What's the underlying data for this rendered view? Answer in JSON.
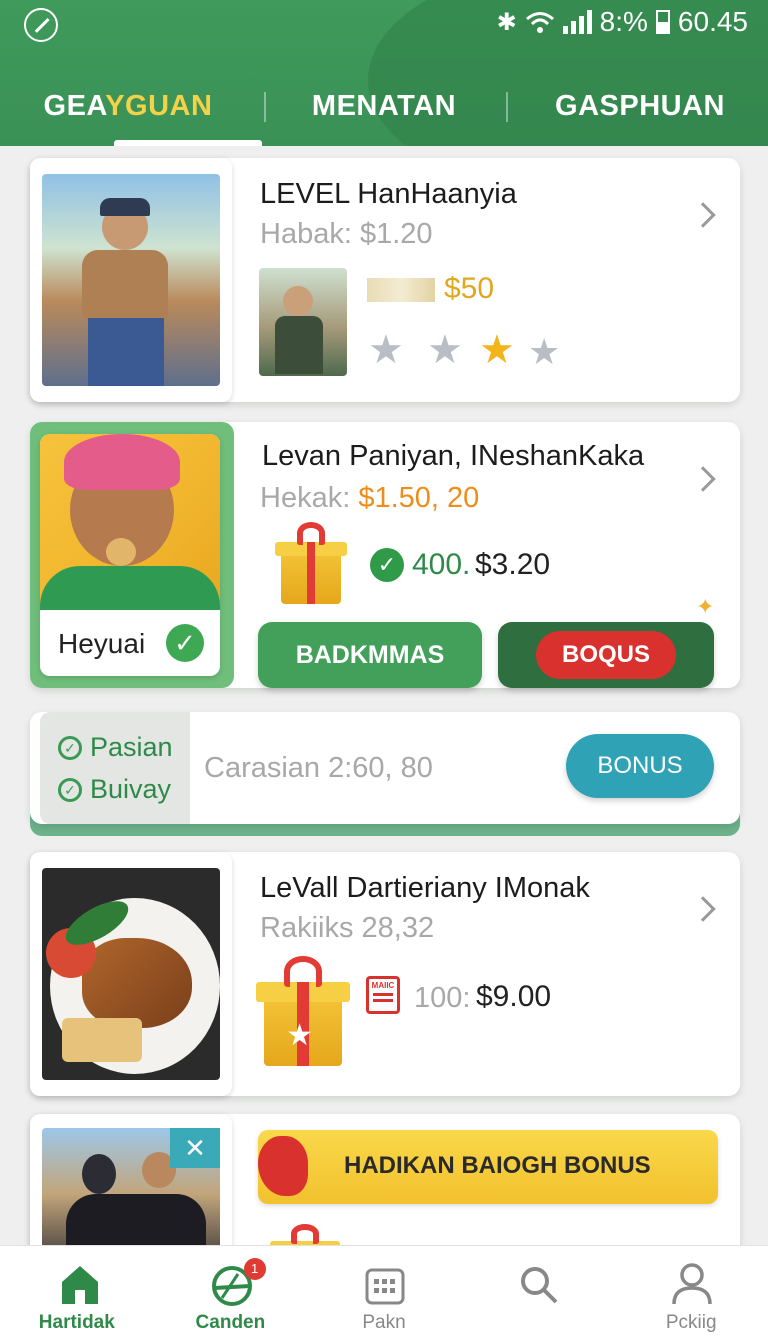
{
  "status": {
    "left_icon": "clock-icon",
    "battery_percent": "8:%",
    "time": "60.45",
    "icons": [
      "bluetooth-icon",
      "wifi-icon",
      "signal-icon",
      "battery-icon"
    ]
  },
  "tabs": [
    {
      "label_a": "GEA",
      "label_b": "YGUAN",
      "active": true
    },
    {
      "label": "MENATAN"
    },
    {
      "label": "GASPHUAN"
    }
  ],
  "cards": {
    "c1": {
      "title": "LEVEL HanHaanyia",
      "price_label": "Habak: $1.20",
      "reward_amount": "$50",
      "stars_filled": 1,
      "stars_total": 4
    },
    "c2": {
      "title": "Levan Paniyan, INeshanKaka",
      "price_prefix": "Hekak:",
      "price_value": "$1.50, 20",
      "count": "400.",
      "amount": "$3.20",
      "badge_label": "Heyuai",
      "btn_primary": "BADKMMAS",
      "btn_bonus": "BOQUS"
    },
    "c3": {
      "opt1": "Pasian",
      "opt2": "Buivay",
      "summary": "Carasian 2:60, 80",
      "btn": "BONUS"
    },
    "c4": {
      "title": "LeVall Dartieriany IMonak",
      "price_label": "Rakiiks 28,32",
      "calendar_text": "MAIIC",
      "count": "100:",
      "amount": "$9.00"
    },
    "c5": {
      "banner": "HADIKAN BAIOGH BONUS"
    }
  },
  "nav": [
    {
      "label": "Hartidak",
      "icon": "home-icon",
      "active": true
    },
    {
      "label": "Canden",
      "icon": "bowl-icon",
      "badge": "1"
    },
    {
      "label": "Pakn",
      "icon": "calendar-icon"
    },
    {
      "label": "",
      "icon": "search-icon"
    },
    {
      "label": "Pckiig",
      "icon": "profile-icon"
    }
  ],
  "colors": {
    "brand_green": "#3f9a5b",
    "accent_yellow": "#f3d24a",
    "bonus_red": "#d9312e",
    "bonus_teal": "#2fa3b5",
    "price_orange": "#f08c1a"
  }
}
